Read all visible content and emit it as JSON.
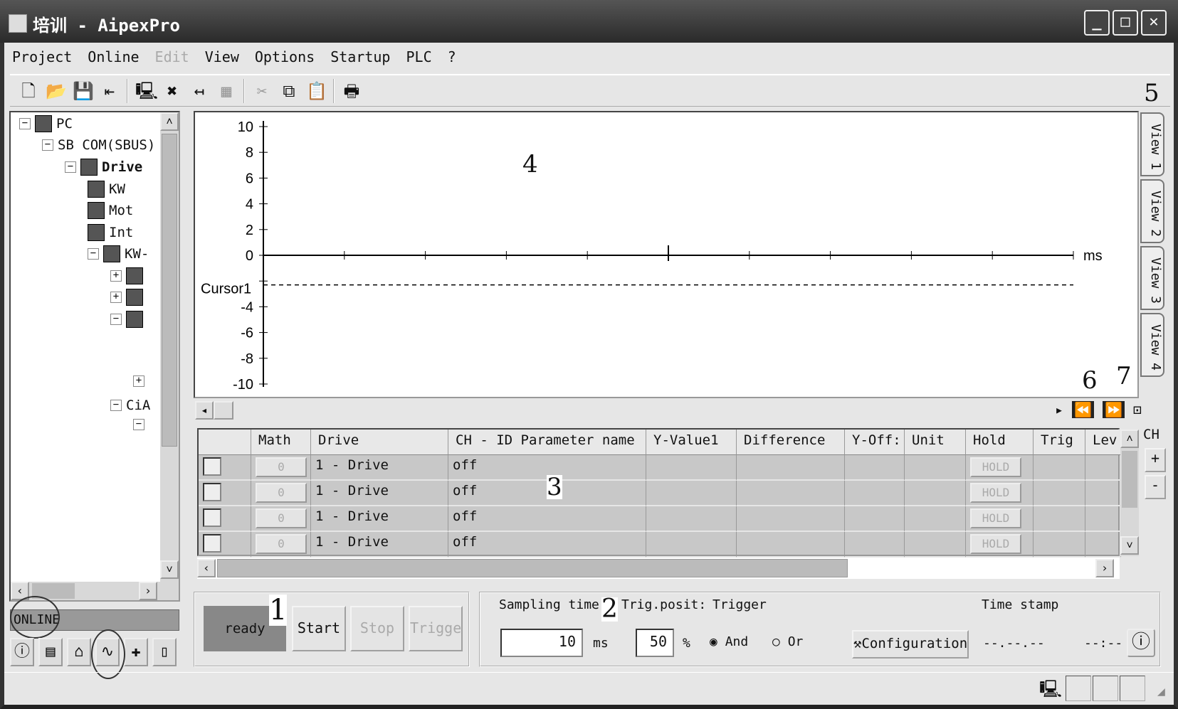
{
  "window": {
    "title": "培训 - AipexPro",
    "buttons": [
      "minimize",
      "maximize",
      "close"
    ]
  },
  "menu": [
    {
      "label": "Project"
    },
    {
      "label": "Online"
    },
    {
      "label": "Edit",
      "disabled": true
    },
    {
      "label": "View"
    },
    {
      "label": "Options"
    },
    {
      "label": "Startup"
    },
    {
      "label": "PLC"
    },
    {
      "label": "?"
    }
  ],
  "toolbar": [
    {
      "icon": "new-file-icon",
      "glyph": "🗋"
    },
    {
      "icon": "open-folder-icon",
      "glyph": "📂"
    },
    {
      "icon": "save-icon",
      "glyph": "💾"
    },
    {
      "icon": "import-icon",
      "glyph": "⇤"
    },
    {
      "sep": true
    },
    {
      "icon": "connect-icon",
      "glyph": "🖳"
    },
    {
      "icon": "disconnect-icon",
      "glyph": "✖"
    },
    {
      "icon": "download-icon",
      "glyph": "↤"
    },
    {
      "icon": "calculator-icon",
      "glyph": "▦",
      "disabled": true
    },
    {
      "sep": true
    },
    {
      "icon": "cut-icon",
      "glyph": "✂",
      "disabled": true
    },
    {
      "icon": "copy-icon",
      "glyph": "⧉"
    },
    {
      "icon": "paste-icon",
      "glyph": "📋",
      "disabled": true
    },
    {
      "sep": true
    },
    {
      "icon": "print-icon",
      "glyph": "🖶"
    }
  ],
  "tree": {
    "nodes": [
      {
        "label": "PC",
        "exp": "−",
        "icon": "port-icon",
        "level": 0
      },
      {
        "label": "SB COM(SBUS)",
        "exp": "−",
        "icon": "",
        "level": 1
      },
      {
        "label": "Drive",
        "exp": "−",
        "icon": "drive-icon",
        "level": 2,
        "bold": true
      },
      {
        "label": "KW",
        "exp": "",
        "icon": "frame-icon",
        "level": 3
      },
      {
        "label": "Mot",
        "exp": "",
        "icon": "motor-icon",
        "level": 3
      },
      {
        "label": "Int",
        "exp": "",
        "icon": "interface-icon",
        "level": 3
      },
      {
        "label": "KW-",
        "exp": "−",
        "icon": "module-icon",
        "level": 3
      },
      {
        "label": "",
        "exp": "+",
        "icon": "arrows-icon",
        "level": 4
      },
      {
        "label": "",
        "exp": "+",
        "icon": "board-icon",
        "level": 4
      },
      {
        "label": "",
        "exp": "−",
        "icon": "board-icon",
        "level": 4
      },
      {
        "label": "",
        "exp": "",
        "icon": "",
        "level": 5
      },
      {
        "label": "",
        "exp": "",
        "icon": "",
        "level": 5
      },
      {
        "label": "",
        "exp": "+",
        "icon": "",
        "level": 5
      },
      {
        "label": "CiA",
        "exp": "−",
        "icon": "",
        "level": 4
      },
      {
        "label": "",
        "exp": "−",
        "icon": "",
        "level": 5
      }
    ]
  },
  "online_status": "ONLINE",
  "bottom_icons": [
    "info-icon",
    "document-icon",
    "home-icon",
    "oscilloscope-icon",
    "plus-icon",
    "device-icon"
  ],
  "scope": {
    "y_ticks": [
      10,
      8,
      6,
      4,
      2,
      0,
      -2,
      -4,
      -6,
      -8,
      -10
    ],
    "y_range": [
      -10,
      10
    ],
    "x_unit": "ms",
    "cursor_label": "Cursor1",
    "cursor_value": -2.3,
    "x_tick_count": 10
  },
  "view_tabs": [
    "View 1",
    "View 2",
    "View 3",
    "View 4"
  ],
  "annotations": [
    "1",
    "2",
    "3",
    "4",
    "5",
    "6",
    "7"
  ],
  "table": {
    "columns": [
      "",
      "Math",
      "Drive",
      "CH - ID Parameter name",
      "Y-Value1",
      "Difference",
      "Y-Off:",
      "Unit",
      "Hold",
      "Trig",
      "Lev"
    ],
    "rows": [
      {
        "math": "0",
        "drive": "1 - Drive",
        "param": "off",
        "hold": "HOLD"
      },
      {
        "math": "0",
        "drive": "1 - Drive",
        "param": "off",
        "hold": "HOLD"
      },
      {
        "math": "0",
        "drive": "1 - Drive",
        "param": "off",
        "hold": "HOLD"
      },
      {
        "math": "0",
        "drive": "1 - Drive",
        "param": "off",
        "hold": "HOLD"
      }
    ]
  },
  "ch": {
    "label": "CH",
    "plus": "+",
    "minus": "-"
  },
  "control": {
    "status": "ready",
    "start": "Start",
    "stop": "Stop",
    "trigger": "Trigger"
  },
  "settings": {
    "sampling_label": "Sampling time",
    "sampling_value": "10",
    "sampling_unit": "ms",
    "trig_label": "Trig.posit:",
    "trig_value": "50",
    "trig_unit": "%",
    "trigger_label": "Trigger",
    "and": "And",
    "or": "Or",
    "and_selected": true,
    "config": "Configuration",
    "timestamp_label": "Time stamp",
    "date": "--.--.--",
    "time": "--:--"
  }
}
